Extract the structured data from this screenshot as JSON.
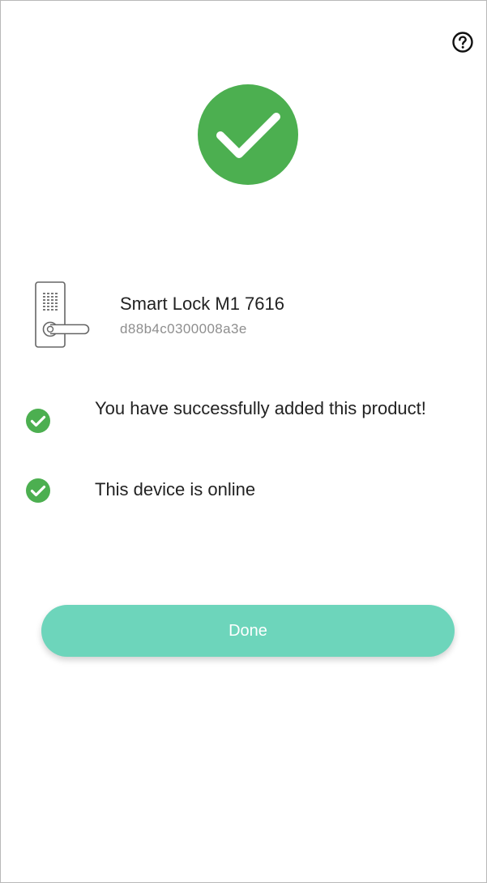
{
  "header": {
    "help_icon": "question-circle-icon"
  },
  "success": {
    "icon": "check-circle-icon",
    "color": "#4caf50"
  },
  "device": {
    "icon": "smart-lock-icon",
    "name": "Smart Lock M1 7616",
    "id": "d88b4c0300008a3e"
  },
  "statuses": [
    {
      "icon": "check-circle-icon",
      "text": "You have successfully added this product!"
    },
    {
      "icon": "check-circle-icon",
      "text": "This device is online"
    }
  ],
  "actions": {
    "done_label": "Done",
    "done_color": "#6dd5bb"
  }
}
